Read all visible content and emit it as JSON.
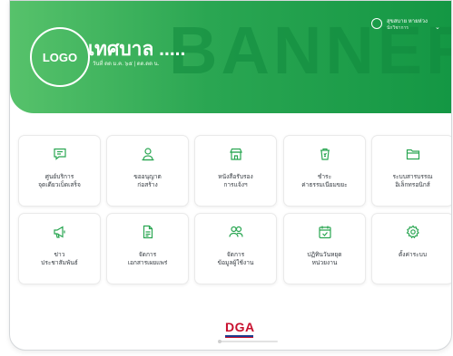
{
  "banner": {
    "watermark": "BANNER",
    "logo_text": "LOGO",
    "municipality": "เทศบาล .....",
    "date_line": "วันที่ ดด ม.ค. ๖๕ | ดด.ดด น.",
    "accent_color": "#2aa652"
  },
  "user": {
    "name": "สุขสบาย หายห่วง",
    "role": "นักวิชาการ",
    "avatar_icon": "user-circle-icon",
    "menu_icon": "chevron-down-icon"
  },
  "services": [
    {
      "icon": "chat-bubble-icon",
      "line1": "ศูนย์บริการ",
      "line2": "จุดเดียวเบ็ดเสร็จ"
    },
    {
      "icon": "user-badge-icon",
      "line1": "ขออนุญาต",
      "line2": "ก่อสร้าง"
    },
    {
      "icon": "store-icon",
      "line1": "หนังสือรับรอง",
      "line2": "การแจ้งฯ"
    },
    {
      "icon": "trash-bin-icon",
      "line1": "ชำระ",
      "line2": "ค่าธรรมเนียมขยะ"
    },
    {
      "icon": "folder-icon",
      "line1": "ระบบสารบรรณ",
      "line2": "อิเล็กทรอนิกส์"
    },
    {
      "icon": "megaphone-icon",
      "line1": "ข่าว",
      "line2": "ประชาสัมพันธ์"
    },
    {
      "icon": "document-icon",
      "line1": "จัดการ",
      "line2": "เอกสารเผยแพร่"
    },
    {
      "icon": "users-icon",
      "line1": "จัดการ",
      "line2": "ข้อมูลผู้ใช้งาน"
    },
    {
      "icon": "calendar-check-icon",
      "line1": "ปฏิทินวันหยุด",
      "line2": "หน่วยงาน"
    },
    {
      "icon": "gear-icon",
      "line1": "ตั้งค่าระบบ",
      "line2": ""
    }
  ],
  "footer": {
    "brand": "DGA"
  }
}
